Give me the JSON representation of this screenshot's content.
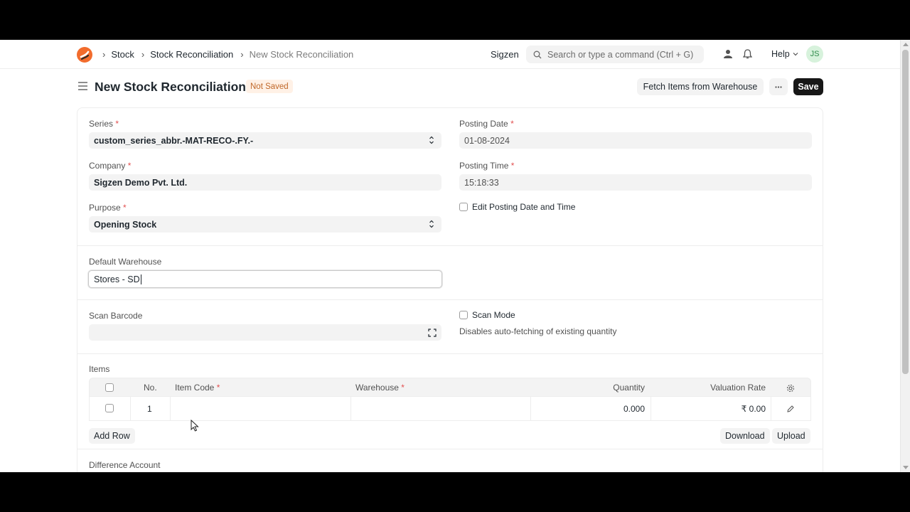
{
  "navbar": {
    "breadcrumbs": [
      "Stock",
      "Stock Reconciliation",
      "New Stock Reconciliation"
    ],
    "brand": "Sigzen",
    "search_placeholder": "Search or type a command (Ctrl + G)",
    "help_label": "Help",
    "avatar_initials": "JS"
  },
  "page": {
    "title": "New Stock Reconciliation",
    "status_badge": "Not Saved",
    "fetch_button": "Fetch Items from Warehouse",
    "more_button": "···",
    "save_button": "Save"
  },
  "form": {
    "series": {
      "label": "Series",
      "value": "custom_series_abbr.-MAT-RECO-.FY.-"
    },
    "posting_date": {
      "label": "Posting Date",
      "value": "01-08-2024"
    },
    "company": {
      "label": "Company",
      "value": "Sigzen Demo Pvt. Ltd."
    },
    "posting_time": {
      "label": "Posting Time",
      "value": "15:18:33"
    },
    "purpose": {
      "label": "Purpose",
      "value": "Opening Stock"
    },
    "edit_posting": {
      "label": "Edit Posting Date and Time",
      "checked": false
    },
    "default_warehouse": {
      "label": "Default Warehouse",
      "value": "Stores - SD"
    },
    "scan_barcode": {
      "label": "Scan Barcode",
      "value": ""
    },
    "scan_mode": {
      "label": "Scan Mode",
      "checked": false,
      "hint": "Disables auto-fetching of existing quantity"
    },
    "difference_account": {
      "label": "Difference Account"
    }
  },
  "items": {
    "label": "Items",
    "columns": {
      "no": "No.",
      "item_code": "Item Code",
      "warehouse": "Warehouse",
      "quantity": "Quantity",
      "valuation_rate": "Valuation Rate"
    },
    "rows": [
      {
        "no": "1",
        "item_code": "",
        "warehouse": "",
        "quantity": "0.000",
        "valuation_rate": "₹ 0.00"
      }
    ],
    "add_row": "Add Row",
    "download": "Download",
    "upload": "Upload"
  },
  "colors": {
    "accent_logo_orange": "#f26c2d",
    "save_bg": "#171717",
    "badge_bg": "#fff1e6",
    "badge_text": "#c0682a",
    "required": "#e25050"
  }
}
